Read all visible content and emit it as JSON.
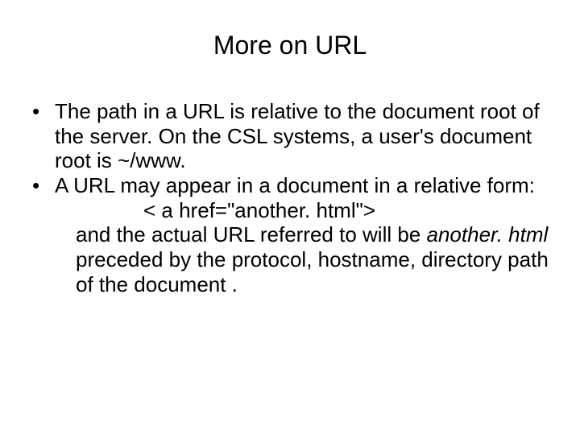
{
  "title": "More on URL",
  "bullets": [
    {
      "text": "The path in a URL is relative to the document root of the server.  On the CSL systems, a user's document root is ~/www."
    },
    {
      "line1": "A URL may appear in a document  in a relative form:",
      "code": "< a href=\"another. html\">",
      "line2_prefix": " and the actual URL referred to will be ",
      "line2_italic": "another. html",
      "line2_suffix": " preceded by the protocol, hostname, directory path of the document ."
    }
  ]
}
